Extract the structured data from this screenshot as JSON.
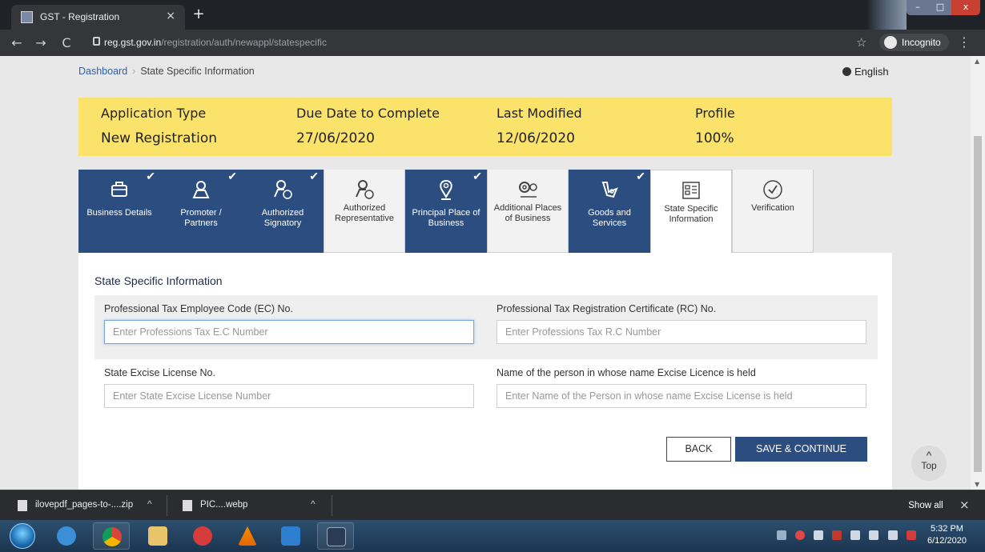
{
  "browser": {
    "tab_title": "GST - Registration",
    "tab_close": "×",
    "new_tab": "+",
    "url_host": "reg.gst.gov.in",
    "url_path": "/registration/auth/newappl/statespecific",
    "incognito_label": "Incognito",
    "window_controls": [
      "–",
      "□",
      "x"
    ]
  },
  "breadcrumb": {
    "dashboard": "Dashboard",
    "separator": "›",
    "current": "State Specific Information"
  },
  "language": "English",
  "summary": {
    "items": [
      {
        "label": "Application Type",
        "value": "New Registration"
      },
      {
        "label": "Due Date to Complete",
        "value": "27/06/2020"
      },
      {
        "label": "Last Modified",
        "value": "12/06/2020"
      },
      {
        "label": "Profile",
        "value": "100%"
      }
    ]
  },
  "steps": [
    {
      "label": "Business Details",
      "state": "done",
      "icon": "briefcase-icon"
    },
    {
      "label": "Promoter / Partners",
      "state": "done",
      "icon": "person-icon"
    },
    {
      "label": "Authorized Signatory",
      "state": "done",
      "icon": "person-check-icon"
    },
    {
      "label": "Authorized Representative",
      "state": "todo",
      "icon": "person-check-icon"
    },
    {
      "label": "Principal Place of Business",
      "state": "done",
      "icon": "location-pin-icon"
    },
    {
      "label": "Additional Places of Business",
      "state": "todo",
      "icon": "multi-location-icon"
    },
    {
      "label": "Goods and Services",
      "state": "done",
      "icon": "tag-icon"
    },
    {
      "label": "State Specific Information",
      "state": "active",
      "icon": "list-icon"
    },
    {
      "label": "Verification",
      "state": "todo",
      "icon": "verified-circle-icon"
    }
  ],
  "form": {
    "title": "State Specific Information",
    "fields": {
      "ec_label": "Professional Tax Employee Code (EC) No.",
      "ec_placeholder": "Enter Professions Tax E.C Number",
      "rc_label": "Professional Tax Registration Certificate (RC) No.",
      "rc_placeholder": "Enter Professions Tax R.C Number",
      "excise_label": "State Excise License No.",
      "excise_placeholder": "Enter State Excise License Number",
      "excise_name_label": "Name of the person in whose name Excise Licence is held",
      "excise_name_placeholder": "Enter Name of the Person in whose name Excise License is held"
    },
    "back_label": "BACK",
    "save_label": "SAVE & CONTINUE"
  },
  "top_button": {
    "caret": "^",
    "label": "Top"
  },
  "downloads": {
    "items": [
      {
        "name": "ilovepdf_pages-to-....zip"
      },
      {
        "name": "PIC....webp"
      }
    ],
    "show_all": "Show all",
    "close": "×"
  },
  "taskbar": {
    "time": "5:32 PM",
    "date": "6/12/2020"
  },
  "colors": {
    "brand_navy": "#2b4d7f",
    "summary_yellow": "#fbe36b",
    "link_blue": "#2c5fa6"
  }
}
